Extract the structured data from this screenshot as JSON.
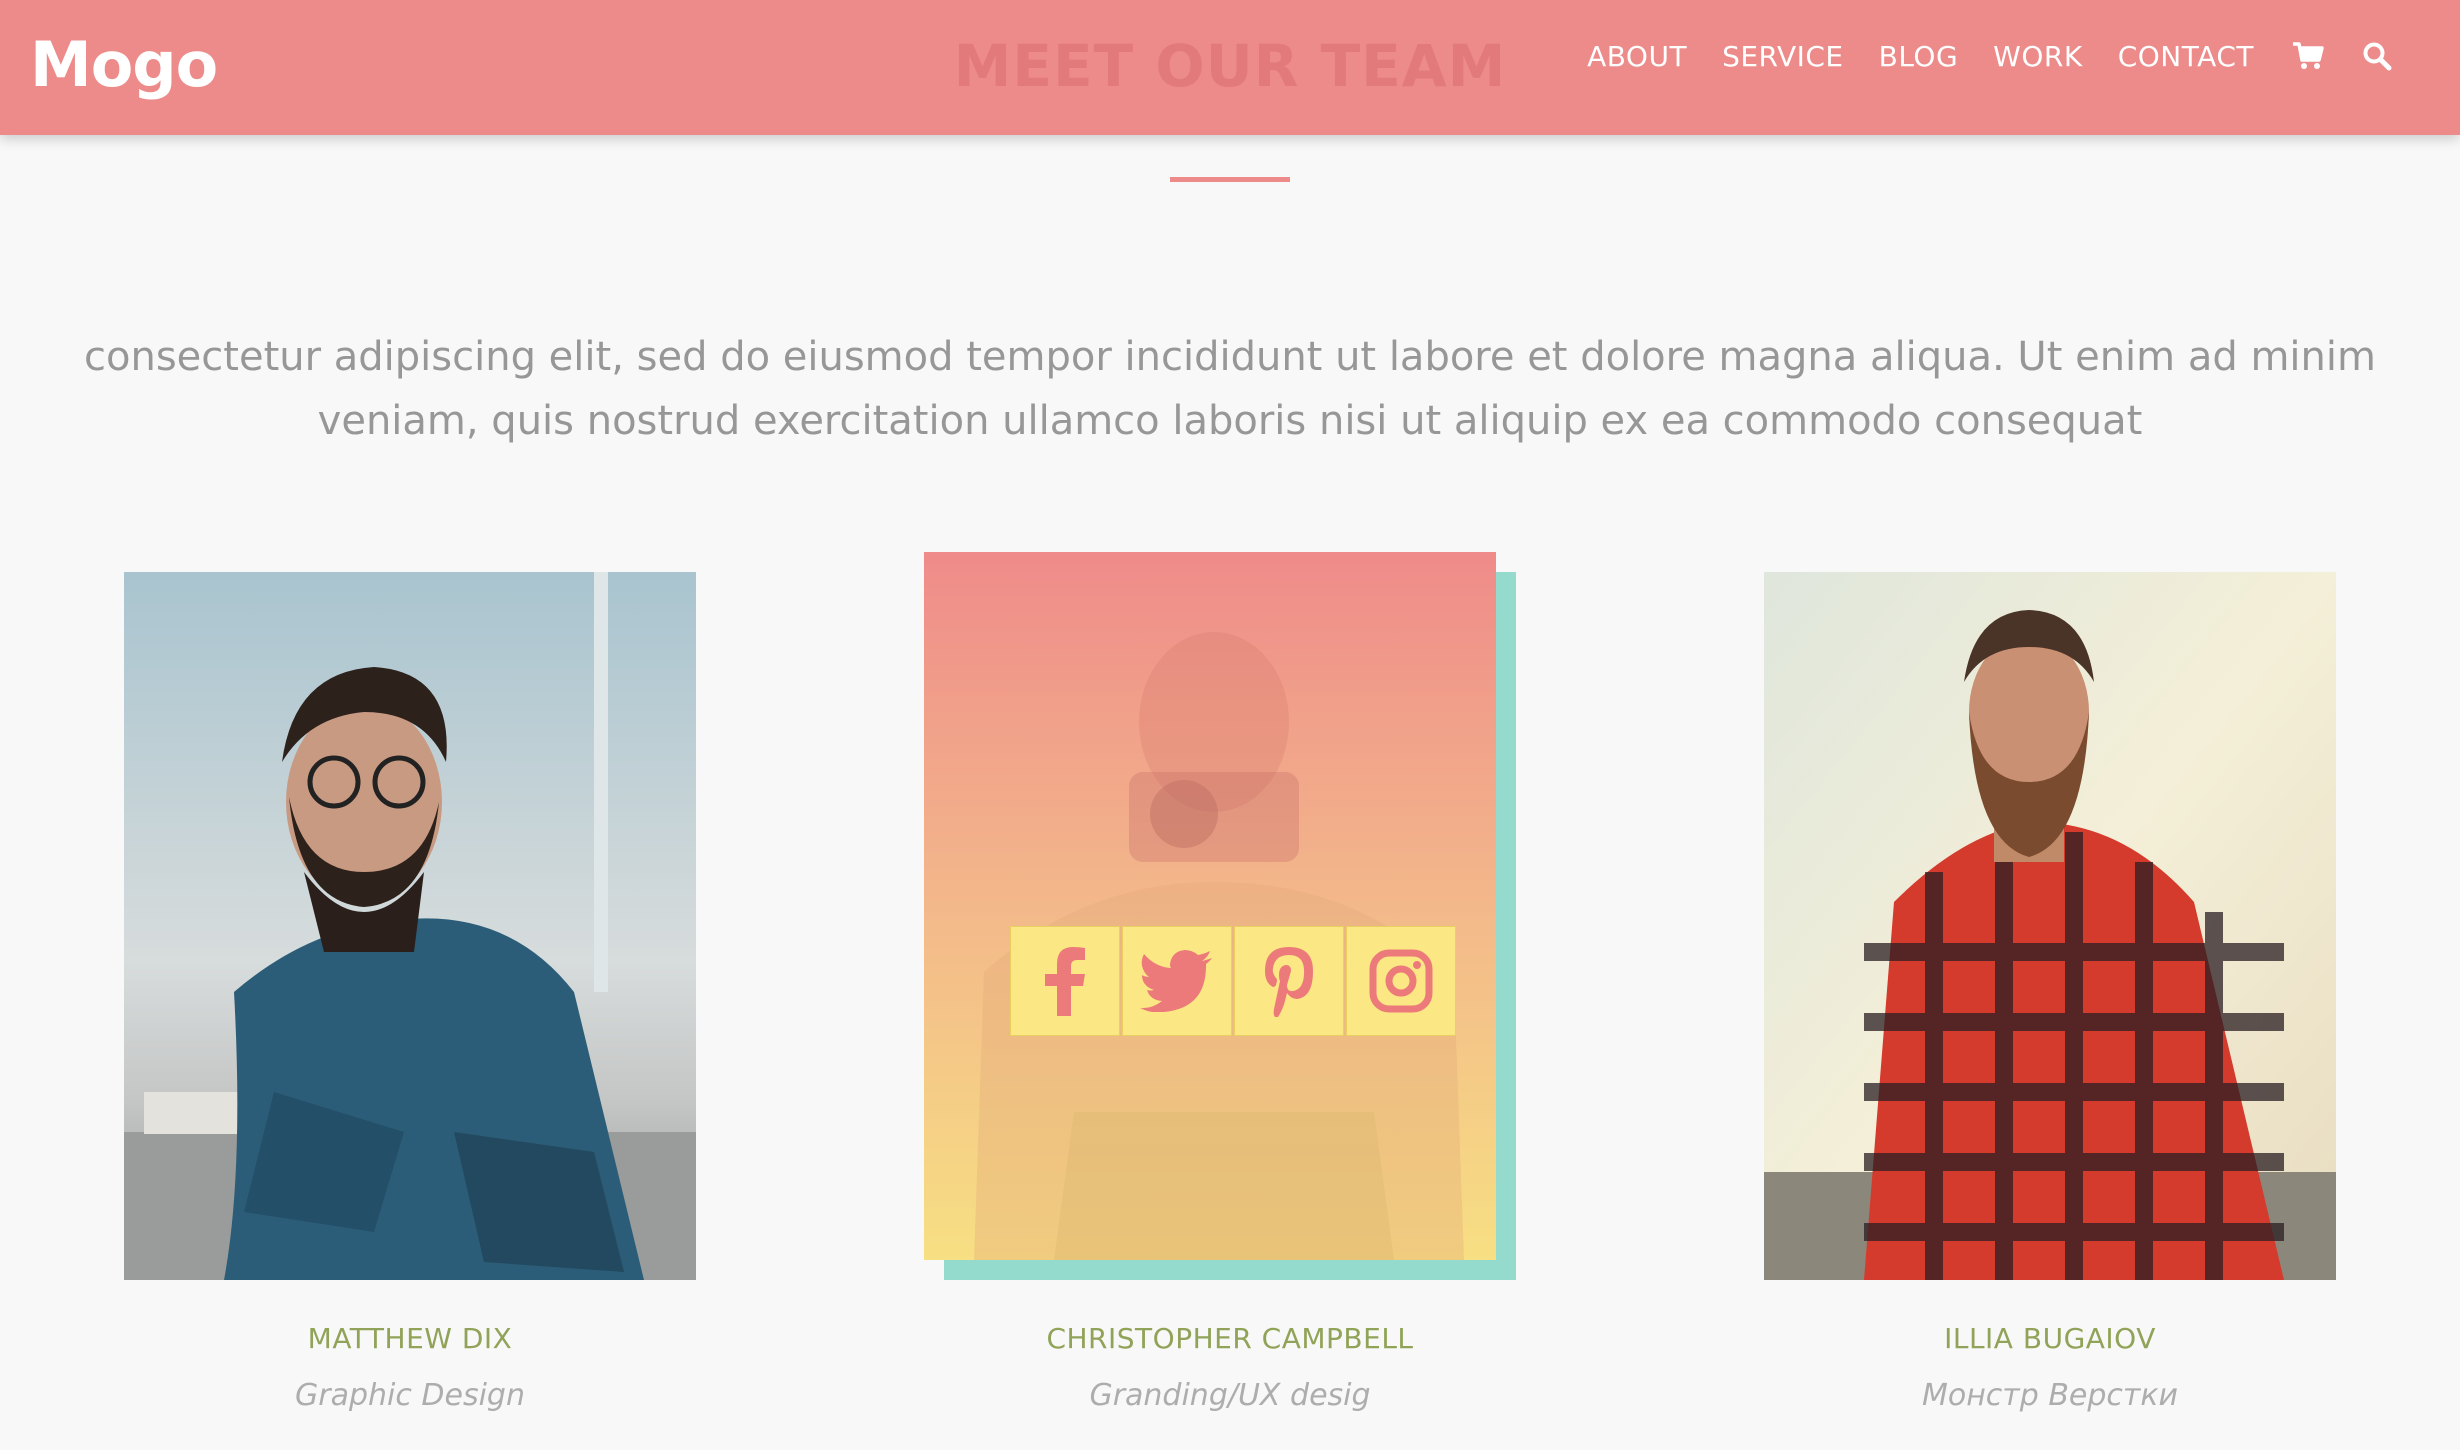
{
  "header": {
    "logo": "Mogo",
    "section_title": "MEET OUR TEAM",
    "nav": [
      "ABOUT",
      "SERVICE",
      "BLOG",
      "WORK",
      "CONTACT"
    ],
    "icons": [
      "cart-icon",
      "search-icon"
    ]
  },
  "intro": {
    "text": "consectetur adipiscing elit, sed do eiusmod tempor incididunt ut labore et dolore magna aliqua. Ut enim ad minim veniam, quis nostrud exercitation ullamco laboris nisi ut aliquip ex ea commodo consequat"
  },
  "team": [
    {
      "name": "MATTHEW DIX",
      "role": "Graphic Design"
    },
    {
      "name": "CHRISTOPHER CAMPBELL",
      "role": "Granding/UX desig"
    },
    {
      "name": "ILLIA BUGAIOV",
      "role": "Монстр Верстки"
    }
  ],
  "social": [
    "facebook-icon",
    "twitter-icon",
    "pinterest-icon",
    "instagram-icon"
  ],
  "colors": {
    "header_bg": "#ec8b8a",
    "accent": "#ec8b8a",
    "name": "#91a358",
    "social_bg": "#fbe783",
    "teal": "#94dbcd"
  }
}
